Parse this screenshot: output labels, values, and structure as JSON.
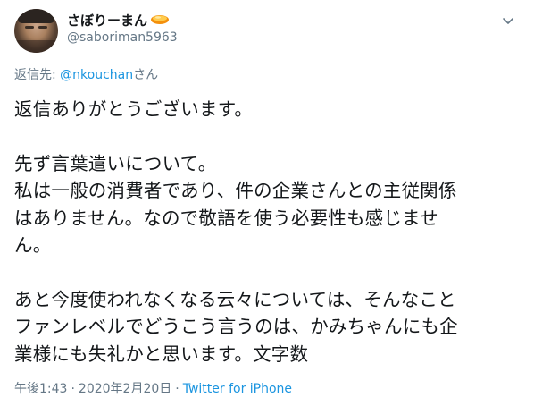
{
  "user": {
    "display_name": "さぼりーまん",
    "handle": "@saboriman5963",
    "emoji_icon": "pudding-icon"
  },
  "reply": {
    "prefix": "返信先: ",
    "mention": "@nkouchan",
    "suffix": "さん"
  },
  "tweet_lines": [
    "返信ありがとうございます。",
    "",
    "先ず言葉遣いについて。",
    "私は一般の消費者であり、件の企業さんとの主従関係",
    "はありません。なので敬語を使う必要性も感じませ",
    "ん。",
    "",
    "あと今度使われなくなる云々については、そんなこと",
    "ファンレベルでどうこう言うのは、かみちゃんにも企",
    "業様にも失礼かと思います。文字数"
  ],
  "meta": {
    "time": "午後1:43",
    "separator": "·",
    "date": "2020年2月20日",
    "source": "Twitter for iPhone"
  },
  "colors": {
    "text": "#14171a",
    "secondary": "#657786",
    "link": "#1b95e0"
  }
}
